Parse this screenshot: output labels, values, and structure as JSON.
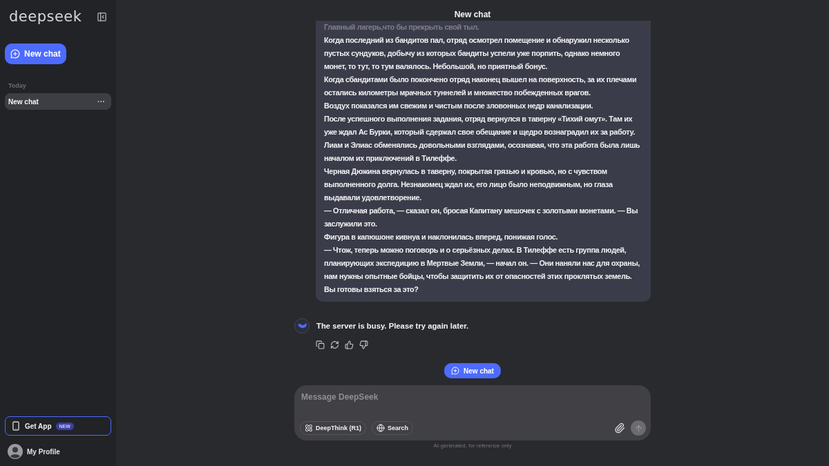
{
  "sidebar": {
    "logo": "deepseek",
    "new_chat_button": "New chat",
    "sections": [
      {
        "heading": "Today",
        "items": [
          {
            "label": "New chat",
            "selected": true,
            "menu": "···"
          }
        ]
      }
    ],
    "get_app": {
      "label": "Get App",
      "badge": "NEW"
    },
    "profile": {
      "name": "My Profile"
    }
  },
  "header": {
    "title": "New chat"
  },
  "messages": [
    {
      "kind": "user",
      "faded_line": "Главный лагерь,что бы прекрыть свой тыл.",
      "paragraphs": [
        "Когда последний из бандитов пал, отряд осмотрел помещение и обнаружил несколько пустых сундуков, добычу из которых бандиты успели уже порпить, однако немного монет, то тут, то тум валялось. Небольшой, но приятный бонус.",
        "Когда сбандитами было покончено отряд наконец вышел на поверхность, за их плечами остались  километры мрачных туннелей и множество побежденных врагов.",
        "Воздух показался им свежим и чистым после зловонных недр канализации.",
        "После успешного выполнения задания, отряд вернулся в таверну «Тихий омут». Там их уже ждал Ас Бурки, который сдержал свое обещание и щедро вознаградил их за работу. Лиам и Элиас обменялись довольными взглядами, осознавая, что эта работа была лишь началом их приключений в Тилеффе.",
        "Черная Дюжина вернулась в таверну, покрытая грязью и кровью, но с чувством выполненного долга. Незнакомец ждал их, его лицо было неподвижным, но глаза выдавали удовлетворение.",
        "— Отличная работа, — сказал он, бросая Капитану мешочек с золотыми монетами. — Вы заслужили это.",
        "Фигура в капюшоне кивнуа и наклонилась вперед, понижая голос.",
        "— Чтож, теперь можно поговорь и о серьёзных делах. В Тилеффе есть группа людей, планирующих экспедицию в Мертвые Земли, — начал он. — Они наняли нас для охраны, нам нужны опытные бойцы, чтобы защитить их от опасностей этих проклятых земель. Вы готовы взяться за это?"
      ]
    },
    {
      "kind": "assistant",
      "text": "The server is busy. Please try again later."
    }
  ],
  "new_chat_button": "New chat",
  "composer": {
    "placeholder": "Message DeepSeek",
    "toggles": [
      {
        "kind": "deepthink",
        "label": "DeepThink (R1)",
        "selected": false
      },
      {
        "kind": "search",
        "label": "Search",
        "selected": false
      }
    ]
  },
  "footer": "AI-generated, for reference only"
}
